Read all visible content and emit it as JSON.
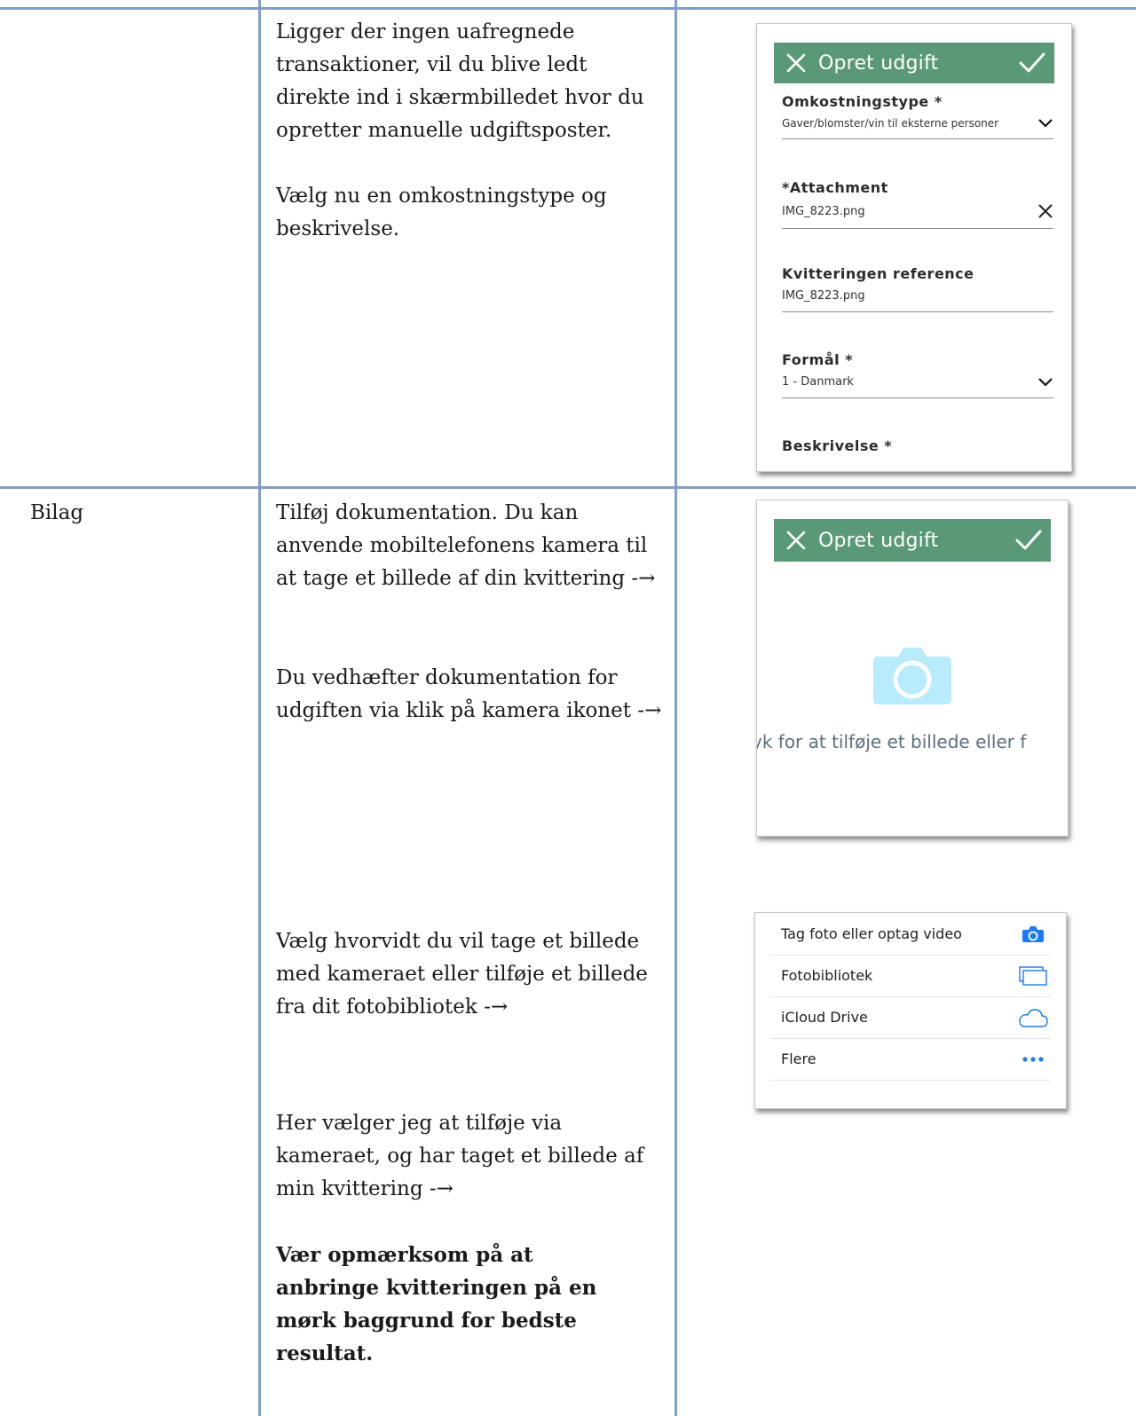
{
  "row1": {
    "paragraphs": [
      "Ligger der ingen uafregnede transaktioner, vil du blive ledt direkte ind i skærmbilledet hvor du opretter manuelle udgiftsposter.",
      "Vælg nu en omkostningstype og beskrivelse."
    ]
  },
  "row2": {
    "label": "Bilag",
    "paragraphs": [
      "Tilføj dokumentation. Du kan anvende mobiltelefonens kamera til at tage et billede af din kvittering -→",
      "Du vedhæfter dokumentation for udgiften via klik på kamera ikonet -→",
      "Vælg hvorvidt du vil tage et billede med kameraet eller tilføje et billede fra dit fotobibliotek -→",
      "Her vælger jeg at tilføje via kameraet, og har taget et billede af min kvittering -→",
      "Vær opmærksom på at anbringe kvitteringen på en mørk baggrund for bedste resultat."
    ]
  },
  "mock1": {
    "title": "Opret udgift",
    "fields": [
      {
        "label": "Omkostningstype *",
        "value": "Gaver/blomster/vin til eksterne personer",
        "icon": "chevron-down-icon"
      },
      {
        "label": "*Attachment",
        "value": "IMG_8223.png",
        "icon": "close-icon"
      },
      {
        "label": "Kvitteringen reference",
        "value": "IMG_8223.png"
      },
      {
        "label": "Formål *",
        "value": "1 - Danmark",
        "icon": "chevron-down-icon"
      },
      {
        "label": "Beskrivelse *"
      }
    ],
    "accent": "#5a9977"
  },
  "mock2": {
    "title": "Opret udgift",
    "tap_text": "yk for at tilføje et billede eller f",
    "camera_color": "#b6ecfb"
  },
  "mock3": {
    "options": [
      {
        "label": "Tag foto eller optag video",
        "icon": "camera-icon"
      },
      {
        "label": "Fotobibliotek",
        "icon": "photo-library-icon"
      },
      {
        "label": "iCloud Drive",
        "icon": "cloud-icon"
      },
      {
        "label": "Flere",
        "icon": "more-icon"
      }
    ],
    "icon_color": "#1a7cf5"
  }
}
